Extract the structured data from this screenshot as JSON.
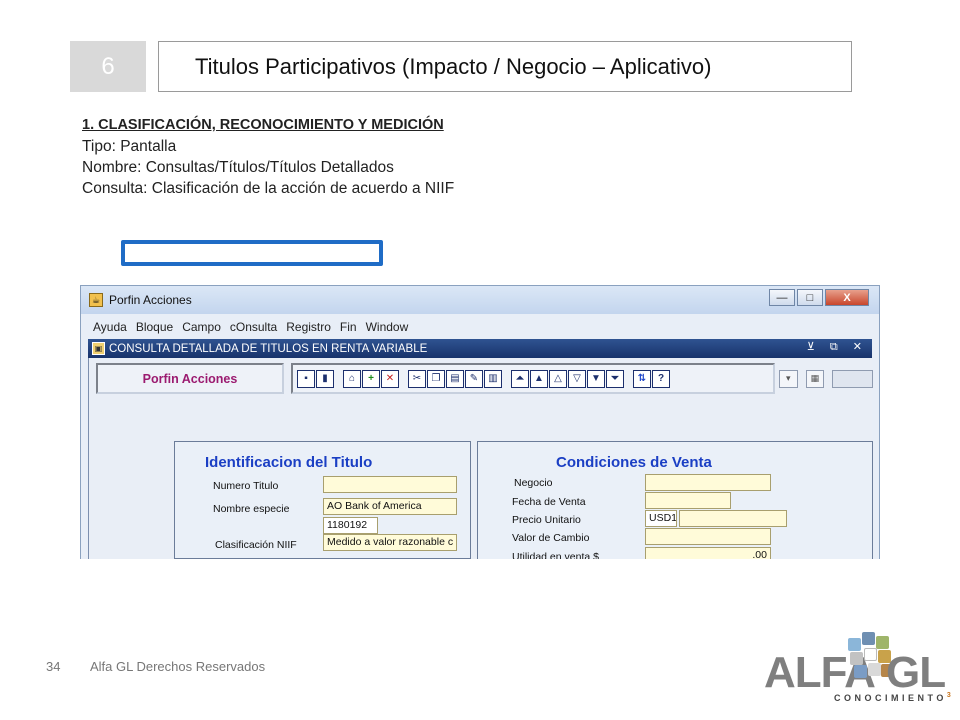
{
  "slide": {
    "number": "6",
    "title": "Titulos Participativos (Impacto / Negocio – Aplicativo)",
    "heading": "1. CLASIFICACIÓN, RECONOCIMIENTO Y MEDICIÓN",
    "lines": [
      "Tipo: Pantalla",
      "Nombre: Consultas/Títulos/Títulos Detallados",
      "Consulta: Clasificación de la acción de acuerdo a NIIF"
    ]
  },
  "window": {
    "title": "Porfin Acciones",
    "minimize": "—",
    "maximize": "□",
    "close": "X",
    "menu": [
      "Ayuda",
      "Bloque",
      "Campo",
      "cOnsulta",
      "Registro",
      "Fin",
      "Window"
    ],
    "subwindow_title": "CONSULTA DETALLADA DE TITULOS EN RENTA VARIABLE",
    "subwindow_controls": "⊻ ⧉ ✕",
    "brand": "Porfin Acciones"
  },
  "left_panel": {
    "title": "Identificacion del Titulo",
    "numero_titulo_label": "Numero Titulo",
    "numero_titulo_value": "",
    "nombre_especie_label": "Nombre especie",
    "nombre_especie_value": "AO Bank of America",
    "consecutivo_value": "1180192",
    "clasificacion_label": "Clasificación NIIF",
    "clasificacion_value": "Medido a valor razonable c"
  },
  "right_panel": {
    "title": "Condiciones de Venta",
    "negocio_label": "Negocio",
    "fecha_venta_label": "Fecha de Venta",
    "precio_unitario_label": "Precio Unitario",
    "precio_unitario_currency": "USD1",
    "valor_cambio_label": "Valor de Cambio",
    "utilidad_label": "Utilidad en venta $",
    "utilidad_value": ".00"
  },
  "footer": {
    "page": "34",
    "text": "Alfa GL Derechos Reservados"
  },
  "logo": {
    "left": "ALFA",
    "right": "GL",
    "sub": "CONOCIMIENTO",
    "sup": "3"
  }
}
